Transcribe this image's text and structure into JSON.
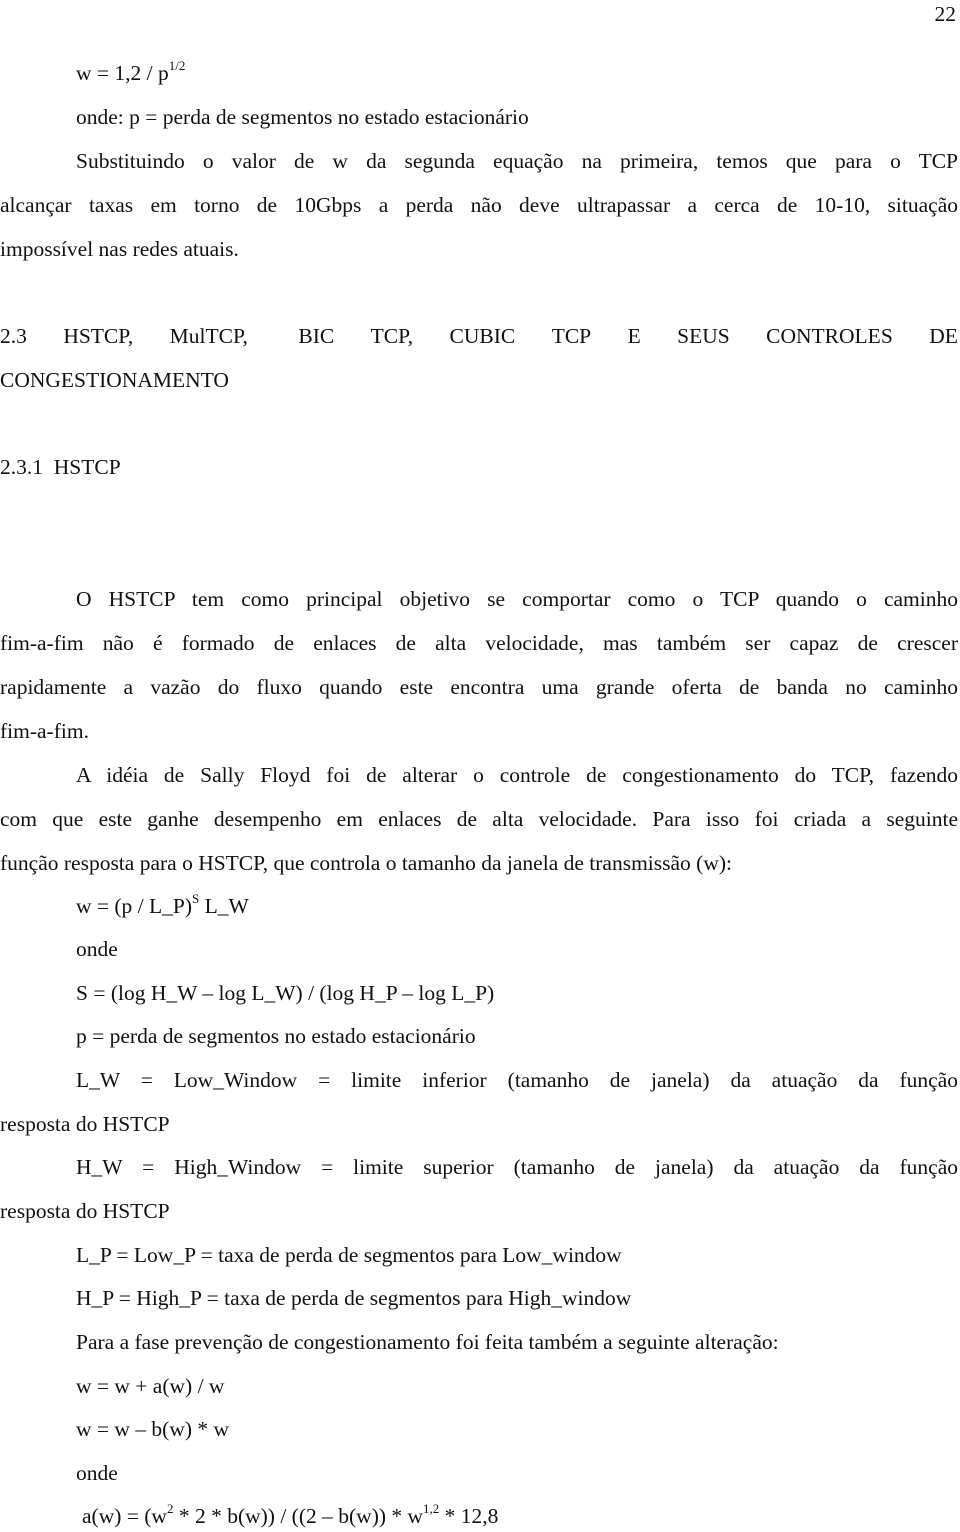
{
  "page_number": "22",
  "intro": {
    "eq1_main": "w = 1,2 / p",
    "eq1_sup": "1/2",
    "eq1_def": "onde: p = perda de segmentos no estado estacionário",
    "para_line1": "Substituindo o valor de w da segunda equação na primeira, temos que para o TCP",
    "para_line2": "alcançar taxas em torno de 10Gbps a perda não deve ultrapassar a cerca de 10-10, situação",
    "para_line3": "impossível nas redes atuais."
  },
  "section": {
    "number": "2.3",
    "title_line1_parts": [
      "HSTCP,",
      "MulTCP,",
      "BIC",
      "TCP,",
      "CUBIC",
      "TCP",
      "E",
      "SEUS",
      "CONTROLES",
      "DE"
    ],
    "title_line2": "CONGESTIONAMENTO"
  },
  "subsection": {
    "title": "2.3.1  HSTCP"
  },
  "body": {
    "p1": [
      "O HSTCP tem como principal objetivo se comportar como o TCP quando o caminho",
      "fim-a-fim não é formado de enlaces de alta velocidade, mas também ser capaz de crescer",
      "rapidamente a vazão do fluxo quando este encontra uma grande oferta de banda no caminho",
      "fim-a-fim."
    ],
    "p2": [
      "A idéia de Sally Floyd foi de alterar o controle de congestionamento do TCP, fazendo",
      "com que este ganhe desempenho em enlaces de alta velocidade. Para isso foi criada a seguinte",
      "função resposta para o HSTCP, que controla o tamanho da janela de transmissão (w):"
    ],
    "eq2_pre": "w = (p / L_P)",
    "eq2_sup": "S",
    "eq2_post": " L_W",
    "onde1": "onde",
    "eq_s": "S = (log H_W – log L_W) / (log H_P – log L_P)",
    "def_p": "p = perda de segmentos no estado estacionário",
    "def_lw_1": "L_W = Low_Window = limite inferior (tamanho de janela) da atuação da função",
    "def_lw_2": "resposta do HSTCP",
    "def_hw_1": "H_W = High_Window = limite superior (tamanho de janela) da atuação da função",
    "def_hw_2": "resposta do HSTCP",
    "def_lp": "L_P = Low_P = taxa de perda de segmentos para Low_window",
    "def_hp": "H_P = High_P = taxa de perda de segmentos para High_window",
    "p3": "Para a fase prevenção de congestionamento foi feita também a seguinte alteração:",
    "eq3": "w = w + a(w) / w",
    "eq4": "w = w – b(w) * w",
    "onde2": "onde",
    "eq5_a": "a(w) = (w",
    "eq5_sup1": "2",
    "eq5_b": " * 2 * b(w)) / ((2 – b(w)) * w",
    "eq5_sup2": "1,2",
    "eq5_c": " * 12,8"
  }
}
